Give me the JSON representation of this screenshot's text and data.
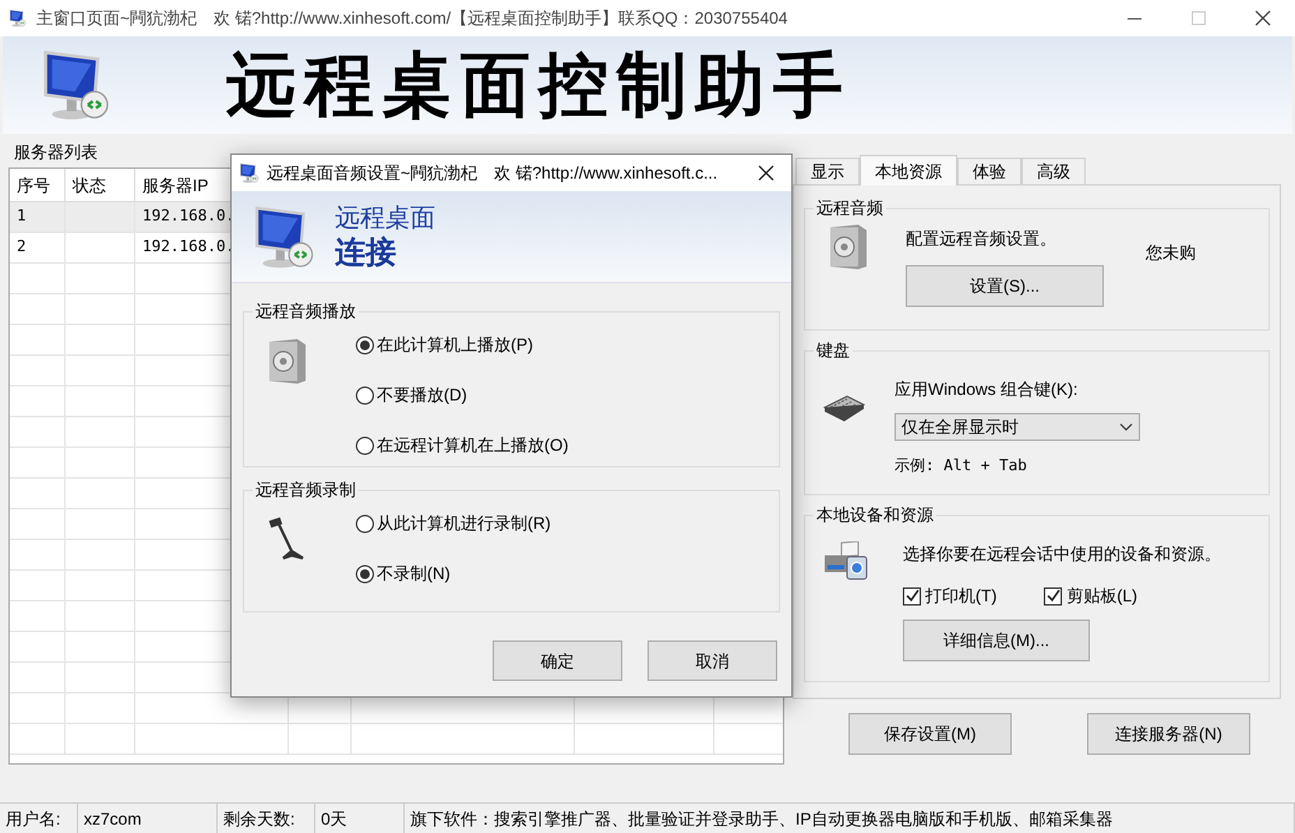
{
  "window": {
    "title": "主窗口页面~闁犺渤杞　欢 锘?http://www.xinhesoft.com/【远程桌面控制助手】联系QQ：2030755404"
  },
  "banner": {
    "title": "远程桌面控制助手"
  },
  "server_list": {
    "label": "服务器列表",
    "columns": [
      "序号",
      "状态",
      "服务器IP"
    ],
    "rows": [
      {
        "cells": [
          "1",
          "",
          "192.168.0."
        ],
        "selected": true
      },
      {
        "cells": [
          "2",
          "",
          "192.168.0."
        ],
        "selected": false
      }
    ]
  },
  "dialog": {
    "title": "远程桌面音频设置~闁犺渤杞　欢 锘?http://www.xinhesoft.c...",
    "header_line1": "远程桌面",
    "header_line2": "连接",
    "playback": {
      "label": "远程音频播放",
      "options": [
        {
          "label": "在此计算机上播放(P)",
          "selected": true
        },
        {
          "label": "不要播放(D)",
          "selected": false
        },
        {
          "label": "在远程计算机在上播放(O)",
          "selected": false
        }
      ]
    },
    "recording": {
      "label": "远程音频录制",
      "options": [
        {
          "label": "从此计算机进行录制(R)",
          "selected": false
        },
        {
          "label": "不录制(N)",
          "selected": true
        }
      ]
    },
    "buttons": [
      "确定",
      "取消"
    ]
  },
  "tabs": [
    {
      "label": "显示",
      "selected": false
    },
    {
      "label": "本地资源",
      "selected": true
    },
    {
      "label": "体验",
      "selected": false
    },
    {
      "label": "高级",
      "selected": false
    }
  ],
  "audio_group": {
    "label": "远程音频",
    "description": "配置远程音频设置。",
    "button": "设置(S)...",
    "note": "您未购"
  },
  "keyboard_group": {
    "label": "键盘",
    "field_label": "应用Windows 组合键(K):",
    "dropdown": "仅在全屏显示时",
    "example": "示例: Alt + Tab"
  },
  "local_group": {
    "label": "本地设备和资源",
    "description": "选择你要在远程会话中使用的设备和资源。",
    "checkboxes": [
      {
        "label": "打印机(T)",
        "checked": true
      },
      {
        "label": "剪贴板(L)",
        "checked": true
      }
    ],
    "button": "详细信息(M)..."
  },
  "actions": [
    "保存设置(M)",
    "连接服务器(N)"
  ],
  "status_bar": {
    "items": [
      "用户名:",
      "xz7com",
      "剩余天数:",
      "0天",
      "旗下软件：搜索引擎推广器、批量验证并登录助手、IP自动更换器电脑版和手机版、邮箱采集器"
    ]
  }
}
